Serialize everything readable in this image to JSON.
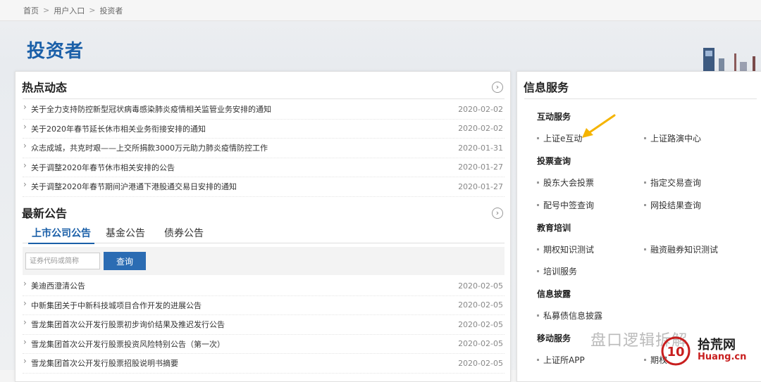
{
  "breadcrumb": {
    "items": [
      "首页",
      "用户入口",
      "投资者"
    ]
  },
  "page_title": "投资者",
  "hot_news": {
    "title": "热点动态",
    "items": [
      {
        "title": "关于全力支持防控新型冠状病毒感染肺炎疫情相关监管业务安排的通知",
        "date": "2020-02-02"
      },
      {
        "title": "关于2020年春节延长休市相关业务衔接安排的通知",
        "date": "2020-02-02"
      },
      {
        "title": "众志成城，共克时艰——上交所捐款3000万元助力肺炎疫情防控工作",
        "date": "2020-01-31"
      },
      {
        "title": "关于调整2020年春节休市相关安排的公告",
        "date": "2020-01-27"
      },
      {
        "title": "关于调整2020年春节期间沪港通下港股通交易日安排的通知",
        "date": "2020-01-27"
      }
    ]
  },
  "announcements": {
    "title": "最新公告",
    "tabs": [
      "上市公司公告",
      "基金公告",
      "债券公告"
    ],
    "search_placeholder": "证券代码或简称",
    "search_button": "查询",
    "items": [
      {
        "title": "美迪西澄清公告",
        "date": "2020-02-05"
      },
      {
        "title": "中新集团关于中新科技城项目合作开发的进展公告",
        "date": "2020-02-05"
      },
      {
        "title": "雪龙集团首次公开发行股票初步询价结果及推迟发行公告",
        "date": "2020-02-05"
      },
      {
        "title": "雪龙集团首次公开发行股票投资风险特别公告（第一次）",
        "date": "2020-02-05"
      },
      {
        "title": "雪龙集团首次公开发行股票招股说明书摘要",
        "date": "2020-02-05"
      }
    ]
  },
  "info_services": {
    "title": "信息服务",
    "groups": {
      "interactive": {
        "title": "互动服务",
        "links": [
          "上证e互动",
          "上证路演中心"
        ]
      },
      "voting": {
        "title": "投票查询",
        "links": [
          "股东大会投票",
          "指定交易查询",
          "配号中签查询",
          "网投结果查询"
        ]
      },
      "education": {
        "title": "教育培训",
        "links": [
          "期权知识测试",
          "融资融券知识测试",
          "培训服务"
        ]
      },
      "disclosure": {
        "title": "信息披露",
        "links": [
          "私募债信息披露"
        ]
      },
      "mobile": {
        "title": "移动服务",
        "links": [
          "上证所APP",
          "期权"
        ]
      }
    }
  },
  "watermark": {
    "text": "盘口逻辑拆解",
    "brand": "拾荒网",
    "url": "Huang.cn",
    "logo_digits": "10"
  },
  "colors": {
    "brand_blue": "#1a5fa8",
    "button_blue": "#2b6cb3",
    "arrow": "#f5b400"
  }
}
